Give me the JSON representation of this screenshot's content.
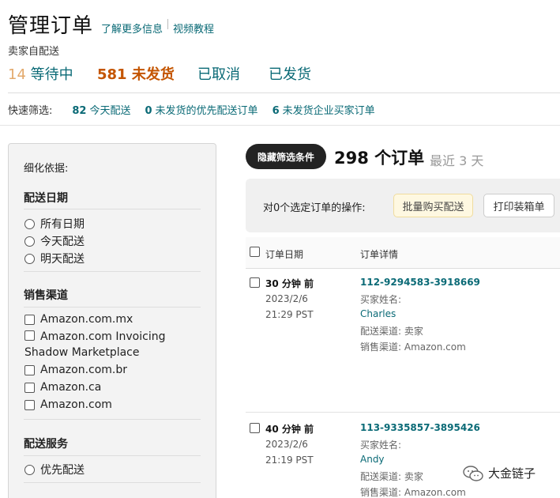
{
  "header": {
    "title": "管理订单",
    "learn_more": "了解更多信息",
    "video_tutorial": "视频教程"
  },
  "seller_fulfilled": "卖家自配送",
  "tabs": [
    {
      "count": "14",
      "label": "等待中"
    },
    {
      "count": "581",
      "label": "未发货"
    },
    {
      "label": "已取消"
    },
    {
      "label": "已发货"
    }
  ],
  "quick_filter": {
    "label": "快速筛选:",
    "items": [
      {
        "count": "82",
        "label": "今天配送"
      },
      {
        "count": "0",
        "label": "未发货的优先配送订单"
      },
      {
        "count": "6",
        "label": "未发货企业买家订单"
      }
    ]
  },
  "sidebar": {
    "title": "细化依据:",
    "ship_date": {
      "heading": "配送日期",
      "options": [
        "所有日期",
        "今天配送",
        "明天配送"
      ]
    },
    "sales_channel": {
      "heading": "销售渠道",
      "options": [
        "Amazon.com.mx",
        "Amazon.com Invoicing Shadow Marketplace",
        "Amazon.com.br",
        "Amazon.ca",
        "Amazon.com"
      ]
    },
    "ship_service": {
      "heading": "配送服务",
      "options": [
        "优先配送"
      ]
    }
  },
  "results": {
    "hide_filters": "隐藏筛选条件",
    "order_count": "298 个订单",
    "range": "最近 3 天"
  },
  "action_bar": {
    "label": "对0个选定订单的操作:",
    "buy_shipping": "批量购买配送",
    "print_packing": "打印装箱单"
  },
  "table": {
    "col_date": "订单日期",
    "col_detail": "订单详情",
    "rows": [
      {
        "age": "30 分钟 前",
        "date": "2023/2/6",
        "time": "21:29 PST",
        "order_id": "112-9294583-3918669",
        "buyer_label": "买家姓名:",
        "buyer_name": "Charles",
        "fulfillment": "配送渠道: 卖家",
        "sales_channel": "销售渠道: Amazon.com"
      },
      {
        "age": "40 分钟 前",
        "date": "2023/2/6",
        "time": "21:19 PST",
        "order_id": "113-9335857-3895426",
        "buyer_label": "买家姓名:",
        "buyer_name": "Andy",
        "fulfillment": "配送渠道: 卖家",
        "sales_channel": "销售渠道: Amazon.com"
      }
    ]
  },
  "watermark": "大金链子"
}
